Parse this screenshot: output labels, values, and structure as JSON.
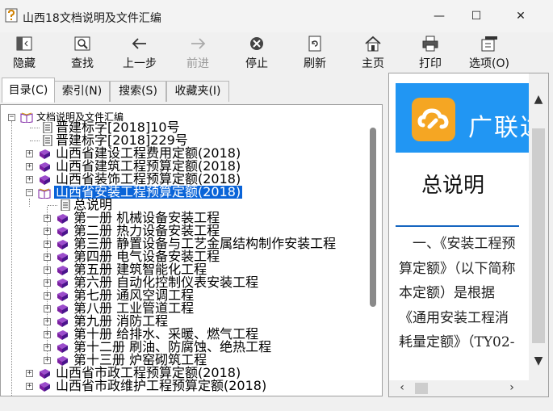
{
  "window": {
    "title": "山西18文档说明及文件汇编",
    "minimize_glyph": "—",
    "maximize_glyph": "☐",
    "close_glyph": "✕"
  },
  "toolbar": {
    "hide": "隐藏",
    "find": "查找",
    "back": "上一步",
    "forward": "前进",
    "stop": "停止",
    "refresh": "刷新",
    "home": "主页",
    "print": "打印",
    "options": "选项(O)"
  },
  "tabs": {
    "contents": "目录(C)",
    "index": "索引(N)",
    "search": "搜索(S)",
    "favorites": "收藏夹(I)"
  },
  "tree": {
    "root": "文档说明及文件汇编",
    "n1": "晋建标字[2018]10号",
    "n2": "晋建标字[2018]229号",
    "n3": "山西省建设工程费用定额(2018)",
    "n4": "山西省建筑工程预算定额(2018)",
    "n5": "山西省装饰工程预算定额(2018)",
    "n6": "山西省安装工程预算定额(2018)",
    "c0": "总说明",
    "c1": "第一册  机械设备安装工程",
    "c2": "第二册  热力设备安装工程",
    "c3": "第三册  静置设备与工艺金属结构制作安装工程",
    "c4": "第四册  电气设备安装工程",
    "c5": "第五册  建筑智能化工程",
    "c6": "第六册  自动化控制仪表安装工程",
    "c7": "第七册  通风空调工程",
    "c8": "第八册  工业管道工程",
    "c9": "第九册  消防工程",
    "c10": "第十册  给排水、采暖、燃气工程",
    "c12": "第十二册  刷油、防腐蚀、绝热工程",
    "c13": "第十三册  炉窑砌筑工程",
    "n7": "山西省市政工程预算定额(2018)",
    "n8": "山西省市政维护工程预算定额(2018)"
  },
  "content": {
    "banner_text": "广联达",
    "heading": "总说明",
    "body": "　一、《安装工程预算定额》（以下简称本定额）是根据《通用安装工程消耗量定额》（TY02-"
  },
  "colors": {
    "selection": "#0a64d8",
    "banner": "#2196f3",
    "book": "#7b1fa2",
    "rule": "#1565c0"
  }
}
